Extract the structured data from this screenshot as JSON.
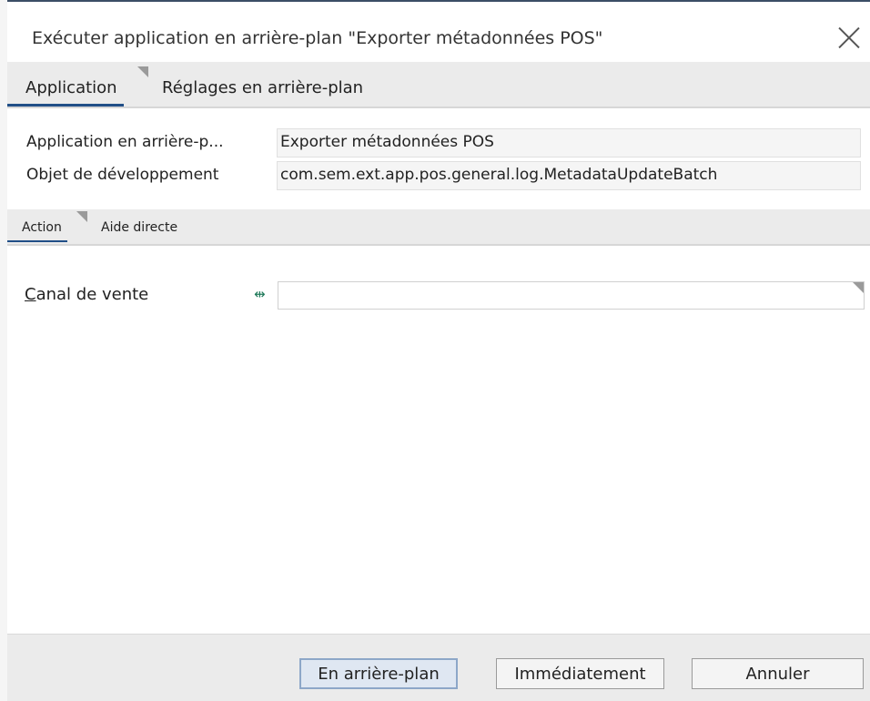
{
  "dialog": {
    "title": "Exécuter application en arrière-plan \"Exporter métadonnées POS\""
  },
  "tabs": [
    {
      "label": "Application"
    },
    {
      "label": "Réglages en arrière-plan"
    }
  ],
  "info": {
    "rows": [
      {
        "label": "Application en arrière-p...",
        "value": "Exporter métadonnées POS"
      },
      {
        "label": "Objet de développement",
        "value": "com.sem.ext.app.pos.general.log.MetadataUpdateBatch"
      }
    ]
  },
  "subtabs": [
    {
      "label": "Action"
    },
    {
      "label": "Aide directe"
    }
  ],
  "form": {
    "channel_label_first": "C",
    "channel_label_rest": "anal de vente",
    "channel_value": "",
    "link_glyph": "⇹"
  },
  "buttons": {
    "background": "En arrière-plan",
    "immediate": "Immédiatement",
    "cancel": "Annuler"
  }
}
